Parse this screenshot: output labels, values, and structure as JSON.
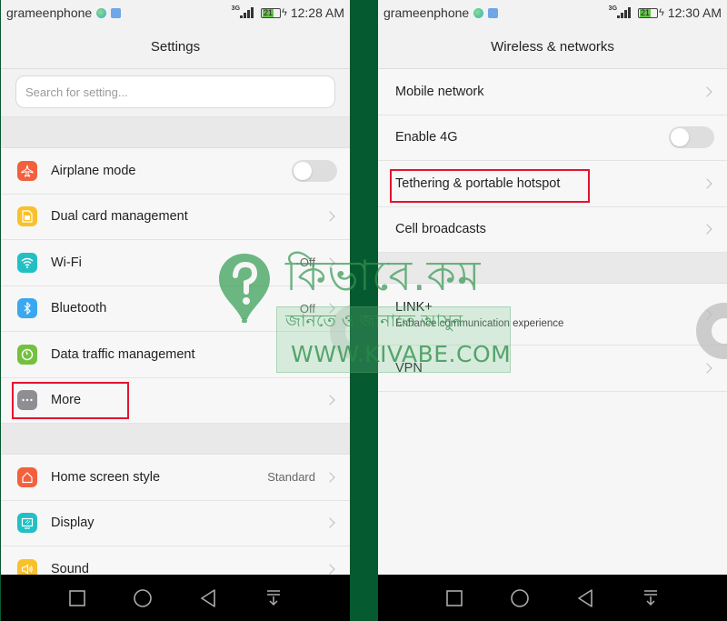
{
  "left": {
    "status": {
      "carrier": "grameenphone",
      "network_type": "3G",
      "battery": "21",
      "time": "12:28 AM"
    },
    "title": "Settings",
    "search": {
      "placeholder": "Search for setting...",
      "value": ""
    },
    "group1": [
      {
        "label": "Airplane mode",
        "icon": "airplane-icon",
        "icon_color": "#f2603e",
        "control": "toggle",
        "toggle_on": false
      },
      {
        "label": "Dual card management",
        "icon": "sim-card-icon",
        "icon_color": "#f8c12c",
        "control": "chevron"
      },
      {
        "label": "Wi-Fi",
        "icon": "wifi-icon",
        "icon_color": "#22c0c4",
        "value": "Off",
        "control": "chevron"
      },
      {
        "label": "Bluetooth",
        "icon": "bluetooth-icon",
        "icon_color": "#3aa8f0",
        "value": "Off",
        "control": "chevron"
      },
      {
        "label": "Data traffic management",
        "icon": "data-gauge-icon",
        "icon_color": "#74c13f",
        "control": "none"
      },
      {
        "label": "More",
        "icon": "more-dots-icon",
        "icon_color": "#8e8e93",
        "control": "chevron",
        "highlighted": true
      }
    ],
    "group2": [
      {
        "label": "Home screen style",
        "icon": "home-icon",
        "icon_color": "#f2603e",
        "value": "Standard",
        "control": "chevron"
      },
      {
        "label": "Display",
        "icon": "display-icon",
        "icon_color": "#22c0c4",
        "control": "chevron"
      },
      {
        "label": "Sound",
        "icon": "sound-icon",
        "icon_color": "#f8c12c",
        "control": "chevron"
      }
    ]
  },
  "right": {
    "status": {
      "carrier": "grameenphone",
      "network_type": "3G",
      "battery": "21",
      "time": "12:30 AM"
    },
    "title": "Wireless & networks",
    "group1": [
      {
        "label": "Mobile network",
        "control": "chevron"
      },
      {
        "label": "Enable 4G",
        "control": "toggle",
        "toggle_on": false
      },
      {
        "label": "Tethering & portable hotspot",
        "control": "chevron",
        "highlighted": true
      },
      {
        "label": "Cell broadcasts",
        "control": "chevron"
      }
    ],
    "group2": [
      {
        "label": "LINK+",
        "sublabel": "Enhance communication experience",
        "control": "chevron"
      },
      {
        "label": "VPN",
        "control": "chevron"
      }
    ]
  },
  "navbar": [
    "recents-button",
    "home-button",
    "back-button",
    "notification-pulldown-button"
  ],
  "watermark": {
    "bangla_title": "কিভাবে.কম",
    "bangla_tagline": "জানতে ও জানাতে আসুন",
    "url": "WWW.KIVABE.COM"
  },
  "colors": {
    "highlight": "#e3142d",
    "divider": "#065a2f",
    "watermark": "#2f9650"
  }
}
